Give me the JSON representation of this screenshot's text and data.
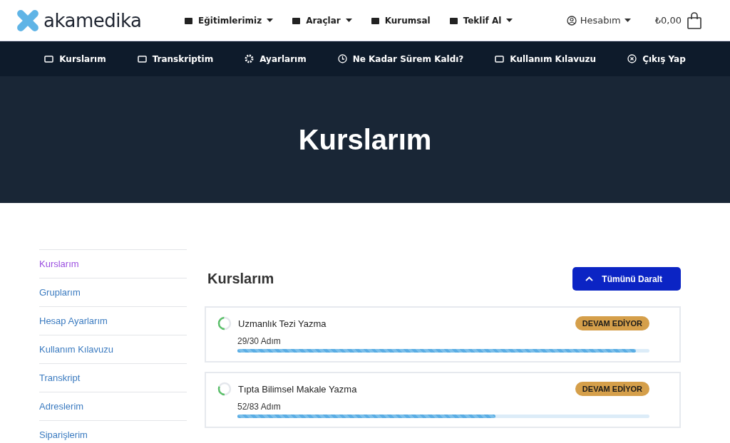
{
  "header": {
    "logo": "akamedika",
    "menu": [
      {
        "label": "Eğitimlerimiz",
        "kind": "dropdown"
      },
      {
        "label": "Araçlar",
        "kind": "dropdown"
      },
      {
        "label": "Kurumsal",
        "kind": "link"
      },
      {
        "label": "Teklif Al",
        "kind": "dropdown"
      }
    ],
    "account": "Hesabım",
    "cart_total": "₺0,00"
  },
  "subnav": [
    "Kurslarım",
    "Transkriptim",
    "Ayarlarım",
    "Ne Kadar Sürem Kaldı?",
    "Kullanım Kılavuzu",
    "Çıkış Yap"
  ],
  "hero": {
    "title": "Kurslarım"
  },
  "sidebar": {
    "items": [
      {
        "label": "Kurslarım",
        "selected": true
      },
      {
        "label": "Gruplarım",
        "selected": false
      },
      {
        "label": "Hesap Ayarlarım",
        "selected": false
      },
      {
        "label": "Kullanım Kılavuzu",
        "selected": false
      },
      {
        "label": "Transkript",
        "selected": false
      },
      {
        "label": "Adreslerim",
        "selected": false
      },
      {
        "label": "Siparişlerim",
        "selected": false
      }
    ]
  },
  "main": {
    "title": "Kurslarım",
    "collapse_button": "Tümünü Daralt",
    "courses": [
      {
        "title": "Uzmanlık Tezi Yazma",
        "status": "DEVAM EDİYOR",
        "steps": "29/30 Adım",
        "level": 0.967
      },
      {
        "title": "Tıpta Bilimsel Makale Yazma",
        "status": "DEVAM EDİYOR",
        "steps": "52/83 Adım",
        "level": 0.627
      }
    ]
  }
}
